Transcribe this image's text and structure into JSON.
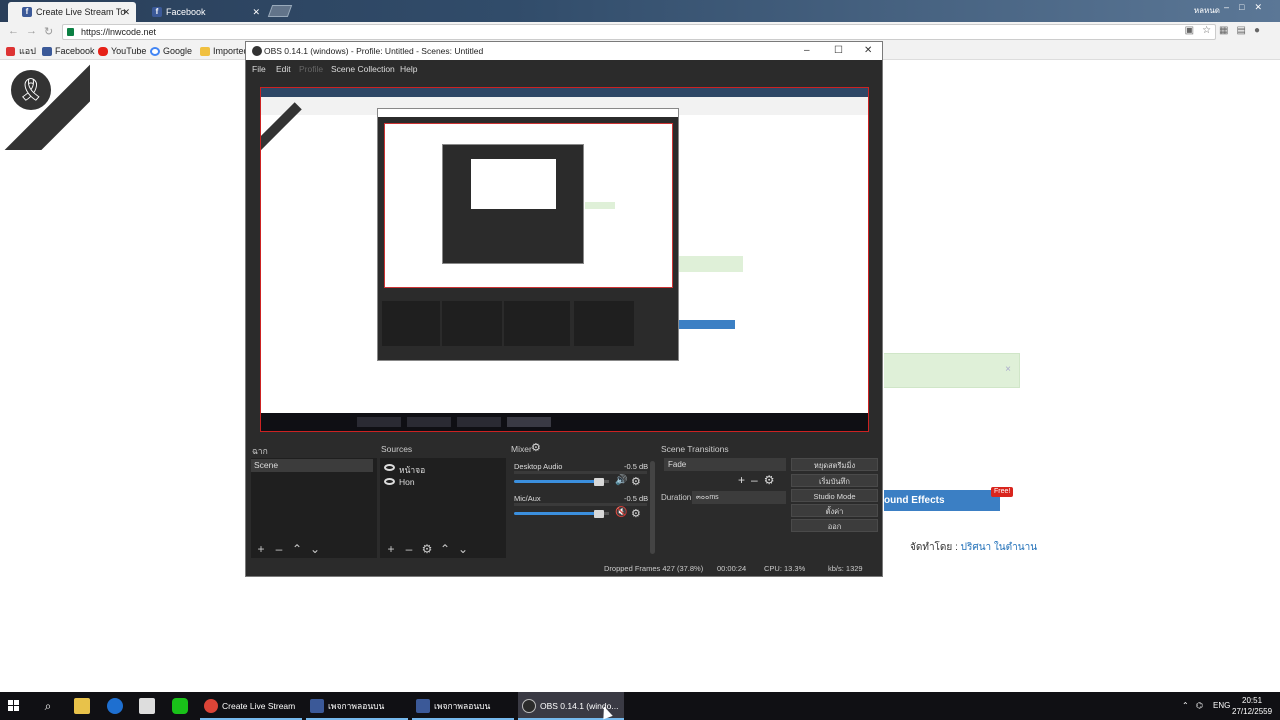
{
  "browser": {
    "tabs": [
      {
        "label": "Create Live Stream To Fa",
        "active": true
      },
      {
        "label": "Facebook",
        "active": false
      }
    ],
    "profile_name": "หลหนด",
    "url": "https://lnwcode.net",
    "bookmarks": [
      "แอป",
      "Facebook",
      "YouTube",
      "Google",
      "Imported"
    ]
  },
  "page": {
    "sound_effects_label": "ound Effects",
    "free_badge": "Free!",
    "byline_prefix": "จัดทำโดย :",
    "byline_author": "ปริศนา ในตำนาน",
    "notice_close": "×"
  },
  "obs": {
    "title": "OBS 0.14.1 (windows) - Profile: Untitled - Scenes: Untitled",
    "menu": [
      "File",
      "Edit",
      "Profile",
      "Scene Collection",
      "Help"
    ],
    "docks": {
      "scenes_title": "ฉาก",
      "sources_title": "Sources",
      "mixer_title": "Mixer",
      "transitions_title": "Scene Transitions"
    },
    "scenes": [
      "Scene"
    ],
    "sources": [
      "หน้าจอ",
      "Hon"
    ],
    "mixer": [
      {
        "name": "Desktop Audio",
        "db": "-0.5 dB",
        "volume": 0.9,
        "muted": false
      },
      {
        "name": "Mic/Aux",
        "db": "-0.5 dB",
        "volume": 0.9,
        "muted": true
      }
    ],
    "transition": "Fade",
    "duration_label": "Duration",
    "duration_value": "๓๐๐ms",
    "controls": [
      "หยุดสตรีมมิ่ง",
      "เริ่มบันทึก",
      "Studio Mode",
      "ตั้งค่า",
      "ออก"
    ],
    "status": {
      "dropped": "Dropped Frames 427 (37.8%)",
      "time": "00:00:24",
      "cpu": "CPU: 13.3%",
      "kbps": "kb/s: 1329"
    }
  },
  "taskbar": {
    "apps": [
      {
        "label": "Create Live Stream ...",
        "active": false
      },
      {
        "label": "เพจกาพลอนบน Faceb...",
        "active": false
      },
      {
        "label": "เพจกาพลอนบน Faceb...",
        "active": false
      },
      {
        "label": "OBS 0.14.1 (windo...",
        "active": true
      }
    ],
    "language": "ENG",
    "time": "20:51",
    "date": "27/12/2559"
  }
}
